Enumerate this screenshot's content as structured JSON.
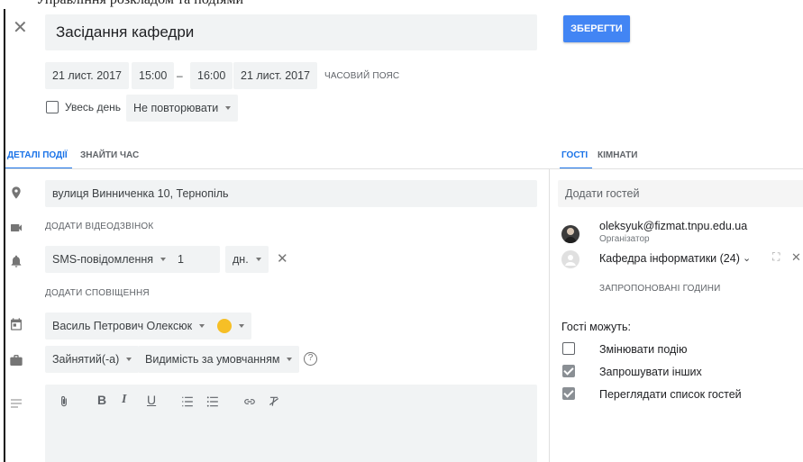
{
  "topline_text": "Управління розкладом та подіями",
  "event": {
    "title": "Засідання кафедри",
    "save_label": "ЗБЕРЕГТИ",
    "start_date": "21 лист. 2017",
    "start_time": "15:00",
    "dash": "–",
    "end_time": "16:00",
    "end_date": "21 лист. 2017",
    "timezone_label": "ЧАСОВИЙ ПОЯС",
    "all_day_label": "Увесь день",
    "all_day_checked": false,
    "repeat_value": "Не повторювати"
  },
  "tabs": {
    "details": "ДЕТАЛІ ПОДІЇ",
    "find_time": "ЗНАЙТИ ЧАС",
    "guests": "ГОСТІ",
    "rooms": "КІМНАТИ"
  },
  "details": {
    "location": "вулиця Винниченка 10, Тернопіль",
    "add_video": "ДОДАТИ ВІДЕОДЗВІНОК",
    "notification_type": "SMS-повідомлення",
    "notification_amount": "1",
    "notification_unit": "дн.",
    "add_notification": "ДОДАТИ СПОВІЩЕННЯ",
    "calendar_owner": "Василь Петрович Олексюк",
    "calendar_color": "#f6bf26",
    "busy_status": "Зайнятий(-а)",
    "visibility": "Видимість за умовчанням",
    "help_glyph": "?"
  },
  "editor_toolbar": {
    "bold": "B",
    "italic": "I",
    "underline": "U"
  },
  "guests": {
    "add_placeholder": "Додати гостей",
    "organizer_email": "oleksyuk@fizmat.tnpu.edu.ua",
    "organizer_role": "Організатор",
    "group_name": "Кафедра інформатики (24)",
    "suggested_times": "ЗАПРОПОНОВАНІ ГОДИНИ",
    "permissions_title": "Гості можуть:",
    "permissions": [
      {
        "label": "Змінювати подію",
        "checked": false
      },
      {
        "label": "Запрошувати інших",
        "checked": true
      },
      {
        "label": "Переглядати список гостей",
        "checked": true
      }
    ]
  },
  "colors": {
    "accent": "#1a73e8",
    "save_button": "#4285f4",
    "field_bg": "#f1f3f4"
  }
}
